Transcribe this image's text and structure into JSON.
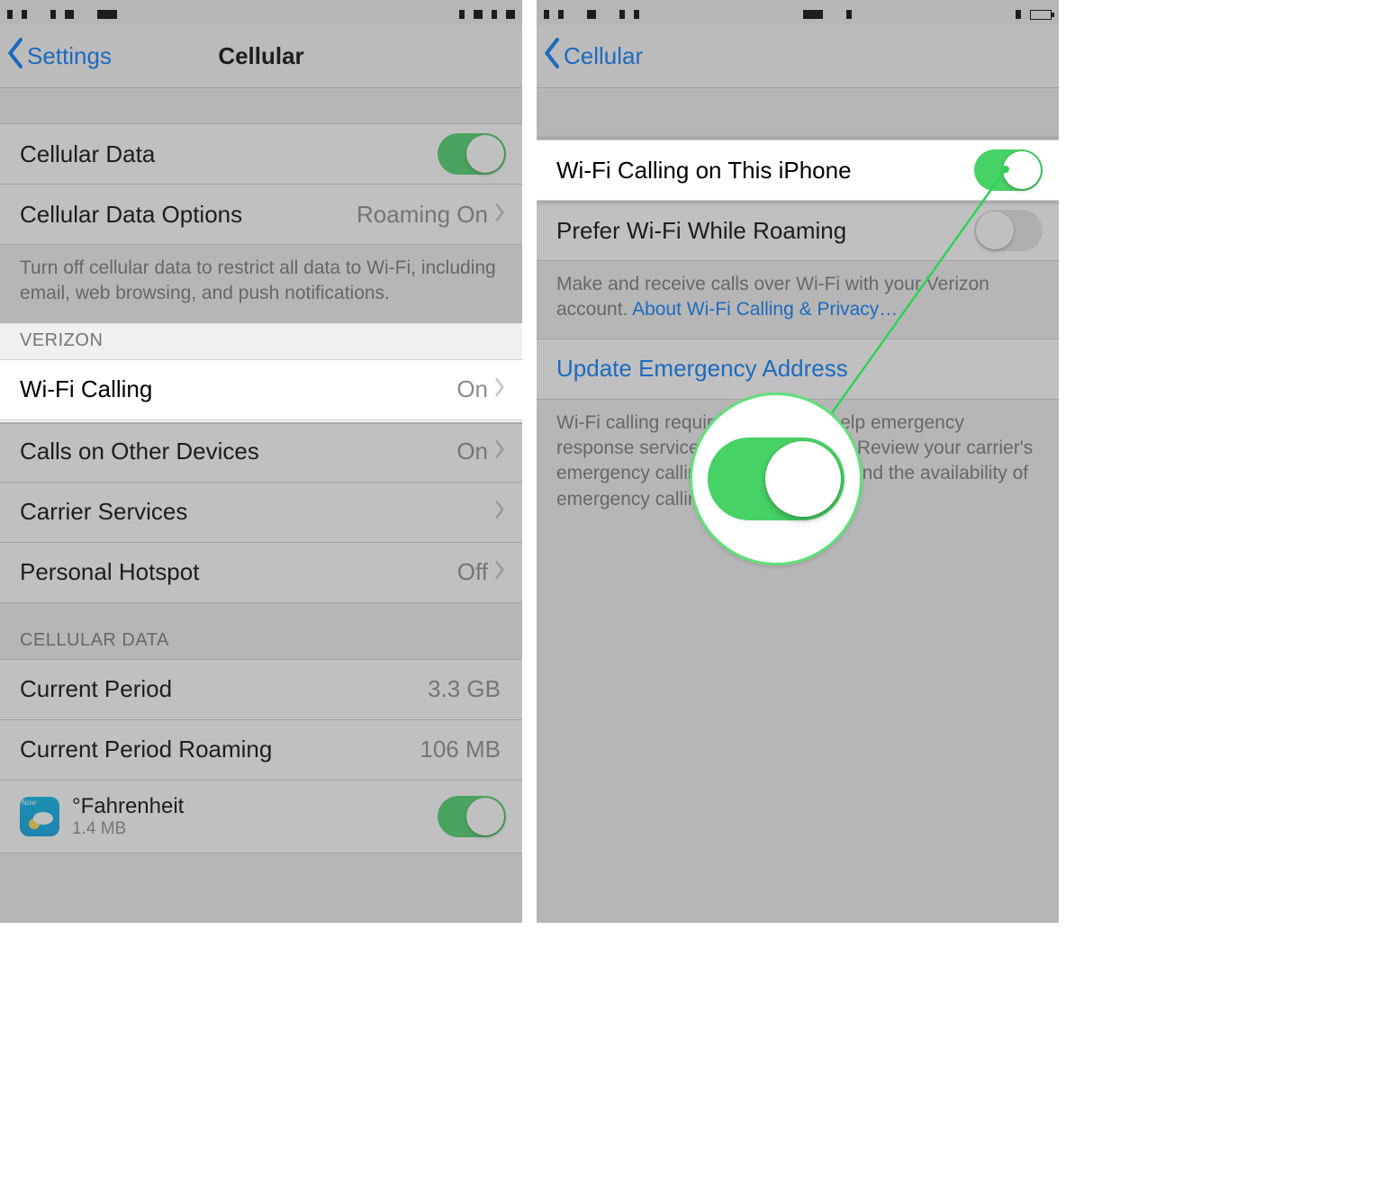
{
  "left": {
    "back_label": "Settings",
    "title": "Cellular",
    "cellular_data_label": "Cellular Data",
    "cellular_data_on": true,
    "cellular_data_options_label": "Cellular Data Options",
    "cellular_data_options_value": "Roaming On",
    "data_off_note": "Turn off cellular data to restrict all data to Wi-Fi, including email, web browsing, and push notifications.",
    "carrier_header": "VERIZON",
    "wifi_calling_label": "Wi-Fi Calling",
    "wifi_calling_value": "On",
    "calls_other_label": "Calls on Other Devices",
    "calls_other_value": "On",
    "carrier_services_label": "Carrier Services",
    "hotspot_label": "Personal Hotspot",
    "hotspot_value": "Off",
    "data_header": "CELLULAR DATA",
    "current_period_label": "Current Period",
    "current_period_value": "3.3 GB",
    "roaming_label": "Current Period Roaming",
    "roaming_value": "106 MB",
    "app_name": "°Fahrenheit",
    "app_size": "1.4 MB",
    "app_badge": "Now"
  },
  "right": {
    "back_label": "Cellular",
    "wifi_on_iphone_label": "Wi-Fi Calling on This iPhone",
    "wifi_on_iphone_on": true,
    "prefer_roaming_label": "Prefer Wi-Fi While Roaming",
    "prefer_roaming_on": false,
    "account_note_prefix": "Make and receive calls over Wi-Fi with your Verizon account. ",
    "account_note_link": "About Wi-Fi Calling & Privacy…",
    "update_addr_label": "Update Emergency Address",
    "emergency_note": "Wi-Fi calling requires location to help emergency response services respond to calls. Review your carrier's emergency calling policy to understand the availability of emergency calling over Wi-Fi."
  }
}
